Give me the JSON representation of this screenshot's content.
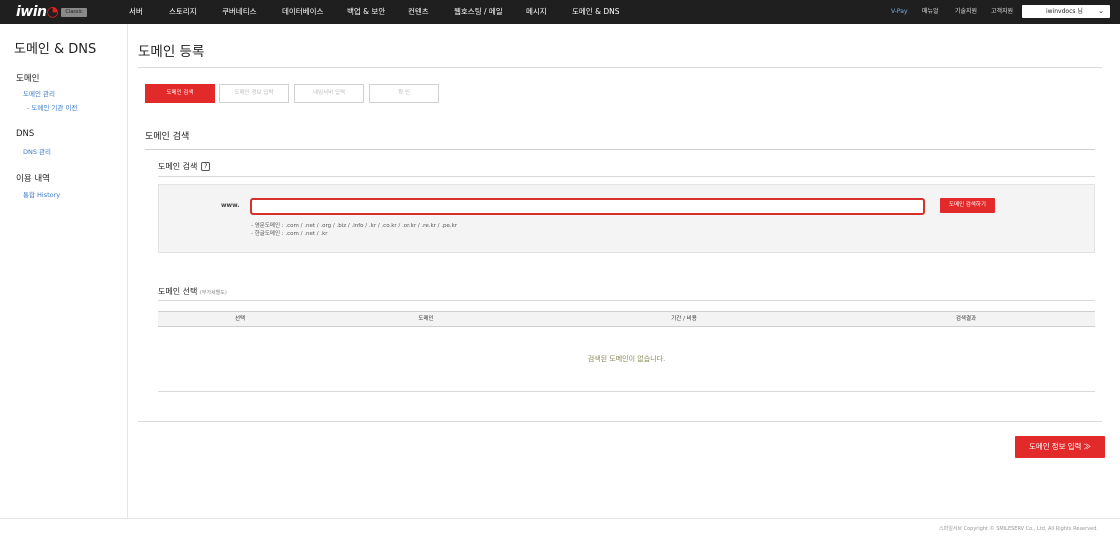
{
  "header": {
    "logo_text": "iwin",
    "logo_badge": "Classic",
    "nav": [
      "서버",
      "스토리지",
      "쿠버네티스",
      "데이터베이스",
      "백업 & 보안",
      "컨텐츠",
      "웹호스팅 / 메일",
      "메시지",
      "도메인 & DNS"
    ],
    "vpay": "V-Pay",
    "right_links": [
      "매뉴얼",
      "기술지원",
      "고객지원"
    ],
    "user": "iwinvdocs 님"
  },
  "sidebar": {
    "title": "도메인 & DNS",
    "groups": [
      {
        "heading": "도메인",
        "links": [
          "도메인 관리",
          "- 도메인 기관 이전"
        ]
      },
      {
        "heading": "DNS",
        "links": [
          "DNS 관리"
        ]
      },
      {
        "heading": "이용 내역",
        "links": [
          "통합 History"
        ]
      }
    ]
  },
  "main": {
    "title": "도메인 등록",
    "steps": [
      "도메인 검색",
      "도메인 정보 입력",
      "네임서버 입력",
      "확 인"
    ],
    "active_step": 0,
    "section_title": "도메인 검색",
    "search": {
      "subtitle": "도메인 검색",
      "help": "?",
      "prefix": "www.",
      "input_value": "",
      "input_placeholder": "",
      "button": "도메인 검색하기",
      "notes": [
        "- 영문도메인 : .com / .net / .org / .biz / .info / .kr / .co.kr / .or.kr / .re.kr / .pe.kr",
        "- 한글도메인 : .com / .net / .kr"
      ]
    },
    "selection": {
      "subtitle": "도메인 선택",
      "subtitle_note": "(부가세별도)",
      "columns": [
        "선택",
        "도메인",
        "기간 / 비용",
        "검색결과"
      ],
      "empty_message": "검색된 도메인이 없습니다."
    },
    "next_button": "도메인 정보 입력 ≫"
  },
  "footer": {
    "copyright": "스마일서브 Copyright © SMILESERV Co., Ltd. All Rights Reserved."
  },
  "colors": {
    "topbar": "#1f1f1f",
    "accent": "#e22a2a",
    "link": "#3a7bc8"
  }
}
